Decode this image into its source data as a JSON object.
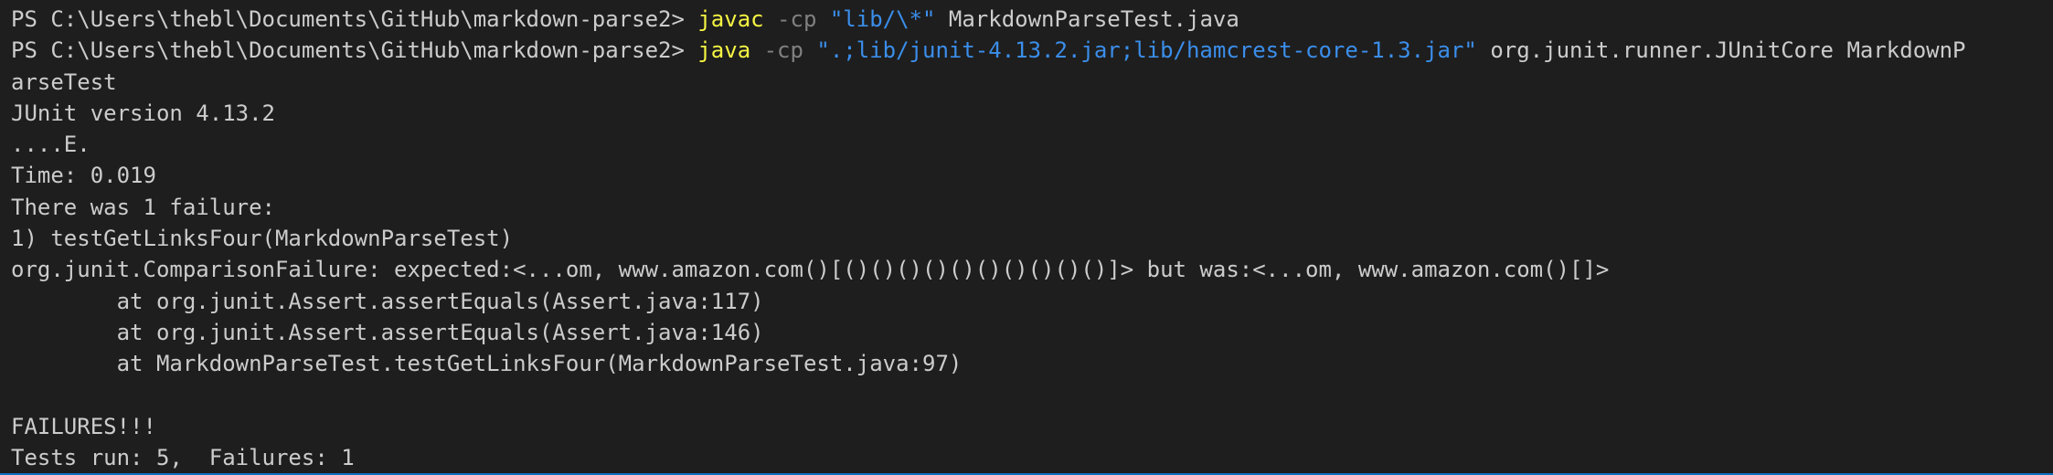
{
  "terminal": {
    "line1": {
      "prompt": "PS C:\\Users\\thebl\\Documents\\GitHub\\markdown-parse2> ",
      "command": "javac",
      "flag": " -cp ",
      "arg": "\"lib/\\*\"",
      "rest": " MarkdownParseTest.java"
    },
    "line2": {
      "prompt": "PS C:\\Users\\thebl\\Documents\\GitHub\\markdown-parse2> ",
      "command": "java",
      "flag": " -cp ",
      "arg": "\".;lib/junit-4.13.2.jar;lib/hamcrest-core-1.3.jar\"",
      "rest": " org.junit.runner.JUnitCore MarkdownP"
    },
    "output": [
      "arseTest",
      "JUnit version 4.13.2",
      "....E.",
      "Time: 0.019",
      "There was 1 failure:",
      "1) testGetLinksFour(MarkdownParseTest)",
      "org.junit.ComparisonFailure: expected:<...om, www.amazon.com()[()()()()()()()()()()]> but was:<...om, www.amazon.com()[]>",
      "        at org.junit.Assert.assertEquals(Assert.java:117)",
      "        at org.junit.Assert.assertEquals(Assert.java:146)",
      "        at MarkdownParseTest.testGetLinksFour(MarkdownParseTest.java:97)",
      "",
      "FAILURES!!!",
      "Tests run: 5,  Failures: 1"
    ]
  },
  "colors": {
    "background": "#1e1e1e",
    "text": "#cccccc",
    "command": "#f5f543",
    "flag": "#808080",
    "string": "#3b8eea",
    "focus_border": "#0e70c0"
  }
}
